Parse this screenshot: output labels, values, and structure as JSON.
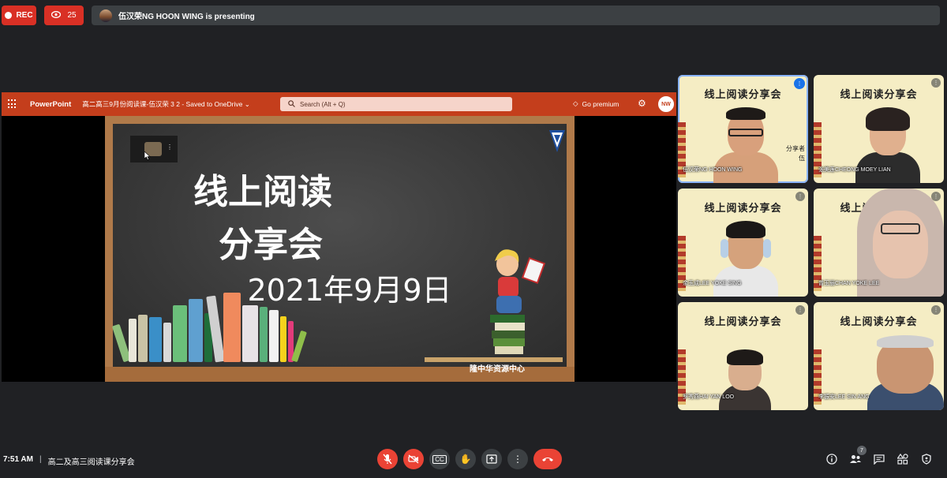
{
  "top": {
    "rec_label": "REC",
    "viewers_count": "25",
    "presenting_text": "伍汉荣NG HOON WING is presenting"
  },
  "ppt": {
    "app_name": "PowerPoint",
    "file_name": "高二高三9月份阅读课-伍汉荣 3 2  -  Saved to OneDrive ⌄",
    "search_placeholder": "Search (Alt + Q)",
    "premium_label": "Go premium",
    "user_initials": "NW"
  },
  "slide": {
    "title_line1": "线上阅读",
    "title_line2": "分享会",
    "date": "2021年9月9日",
    "footer": "隆中华资源中心"
  },
  "participants": [
    {
      "name": "伍汉荣NG HOON WING",
      "banner": "线上阅读分享会",
      "side_text": "分享者\n伍",
      "speaking": true
    },
    {
      "name": "张美莲CHEONG MOEY LIAN",
      "banner": "线上阅读分享会",
      "speaking": false
    },
    {
      "name": "余玉成LEE YOKE SING",
      "banner": "线上阅读分享会",
      "speaking": false
    },
    {
      "name": "曾玉丽CHAN YOKE LEE",
      "banner": "线上阅读分享会",
      "speaking": false
    },
    {
      "name": "罗秀燕HAI YAN LOO",
      "banner": "线上阅读分享会",
      "speaking": false
    },
    {
      "name": "李振安LEE SIN ANG",
      "banner": "线上阅读分享会",
      "speaking": false
    }
  ],
  "bottom": {
    "time": "7:51 AM",
    "separator": "|",
    "meeting_title": "高二及高三阅读课分享会",
    "people_count": "7"
  },
  "colors": {
    "bg": "#202124",
    "rec_red": "#d93025",
    "ppt_orange": "#c43e1c",
    "tile_bg": "#f5edc4",
    "control_red": "#ea4335"
  }
}
